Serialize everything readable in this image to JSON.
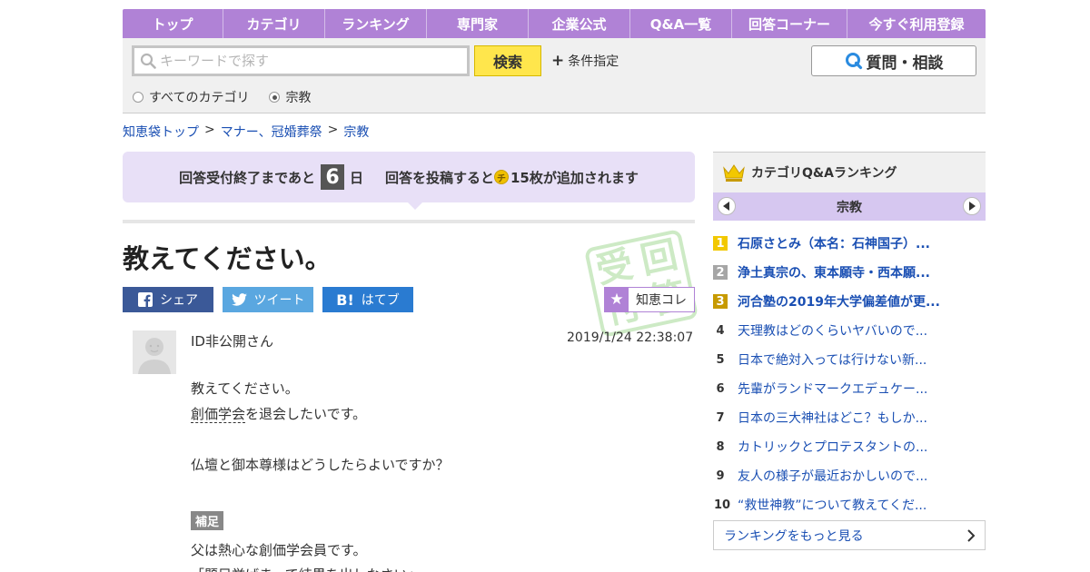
{
  "nav": {
    "items": [
      "トップ",
      "カテゴリ",
      "ランキング",
      "専門家",
      "企業公式",
      "Q&A一覧",
      "回答コーナー",
      "今すぐ利用登録"
    ]
  },
  "search": {
    "placeholder": "キーワードで探す",
    "button": "検索",
    "condition": "条件指定",
    "ask_button": "質問・相談",
    "radio_all": "すべてのカテゴリ",
    "radio_current": "宗教"
  },
  "breadcrumb": {
    "items": [
      "知恵袋トップ",
      "マナー、冠婚葬祭",
      "宗教"
    ],
    "separator": ">"
  },
  "notice": {
    "prefix": "回答受付終了まであと",
    "days": "6",
    "day_unit": "日",
    "middle": "回答を投稿すると",
    "coin_symbol": "チ",
    "suffix": "15枚が追加されます"
  },
  "question": {
    "title": "教えてください。",
    "stamp_chars": [
      "受",
      "回",
      "付",
      "答"
    ],
    "author": "ID非公開さん",
    "timestamp": "2019/1/24  22:38:07",
    "line1": "教えてください。",
    "line2_link": "創価学会",
    "line2_rest": "を退会したいです。",
    "line3": "仏壇と御本尊様はどうしたらよいですか？",
    "supplement_label": "補足",
    "line4": "父は熱心な創価学会員です。",
    "line5": "「題目挙げまって結果を出しなさい」"
  },
  "share": {
    "facebook": "シェア",
    "twitter": "ツイート",
    "hatena": "はてブ",
    "chiekore": "知恵コレ"
  },
  "ranking": {
    "header": "カテゴリQ&Aランキング",
    "category": "宗教",
    "items": [
      {
        "rank": "1",
        "text": "石原さとみ（本名：石神国子）..."
      },
      {
        "rank": "2",
        "text": "浄土真宗の、東本願寺・西本願..."
      },
      {
        "rank": "3",
        "text": "河合塾の2019年大学偏差値が更..."
      },
      {
        "rank": "4",
        "text": "天理教はどのくらいヤバいので..."
      },
      {
        "rank": "5",
        "text": "日本で絶対入っては行けない新..."
      },
      {
        "rank": "6",
        "text": "先輩がランドマークエデュケー..."
      },
      {
        "rank": "7",
        "text": "日本の三大神社はどこ？もしか..."
      },
      {
        "rank": "8",
        "text": "カトリックとプロテスタントの..."
      },
      {
        "rank": "9",
        "text": "友人の様子が最近おかしいので..."
      },
      {
        "rank": "10",
        "text": "“救世神教”について教えてくだ..."
      }
    ],
    "more": "ランキングをもっと見る"
  },
  "colors": {
    "nav": "#b082d6",
    "notice_bg": "#e8e0f7",
    "link": "#1a4fb3",
    "search_button": "#ffe64c"
  }
}
